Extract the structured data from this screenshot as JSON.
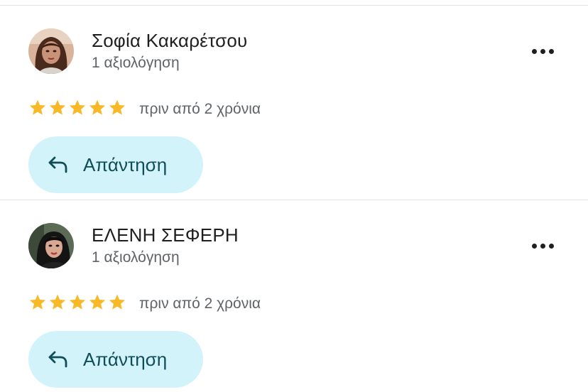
{
  "colors": {
    "star": "#f7b928",
    "reply_button_bg": "#d3f3fb",
    "reply_text": "#0f4d57",
    "secondary_text": "#5f6368",
    "primary_text": "#1f1f1f"
  },
  "reviews": [
    {
      "name": "Σοφία Κακαρέτσου",
      "review_count": "1 αξιολόγηση",
      "rating": 5,
      "rating_max": 5,
      "time_ago": "πριν από 2 χρόνια",
      "reply_label": "Απάντηση",
      "more_icon": "more-horizontal-icon",
      "reply_icon": "reply-arrow-icon"
    },
    {
      "name": "ΕΛΕΝΗ ΣΕΦΕΡΗ",
      "review_count": "1 αξιολόγηση",
      "rating": 5,
      "rating_max": 5,
      "time_ago": "πριν από 2 χρόνια",
      "reply_label": "Απάντηση",
      "more_icon": "more-horizontal-icon",
      "reply_icon": "reply-arrow-icon"
    }
  ]
}
